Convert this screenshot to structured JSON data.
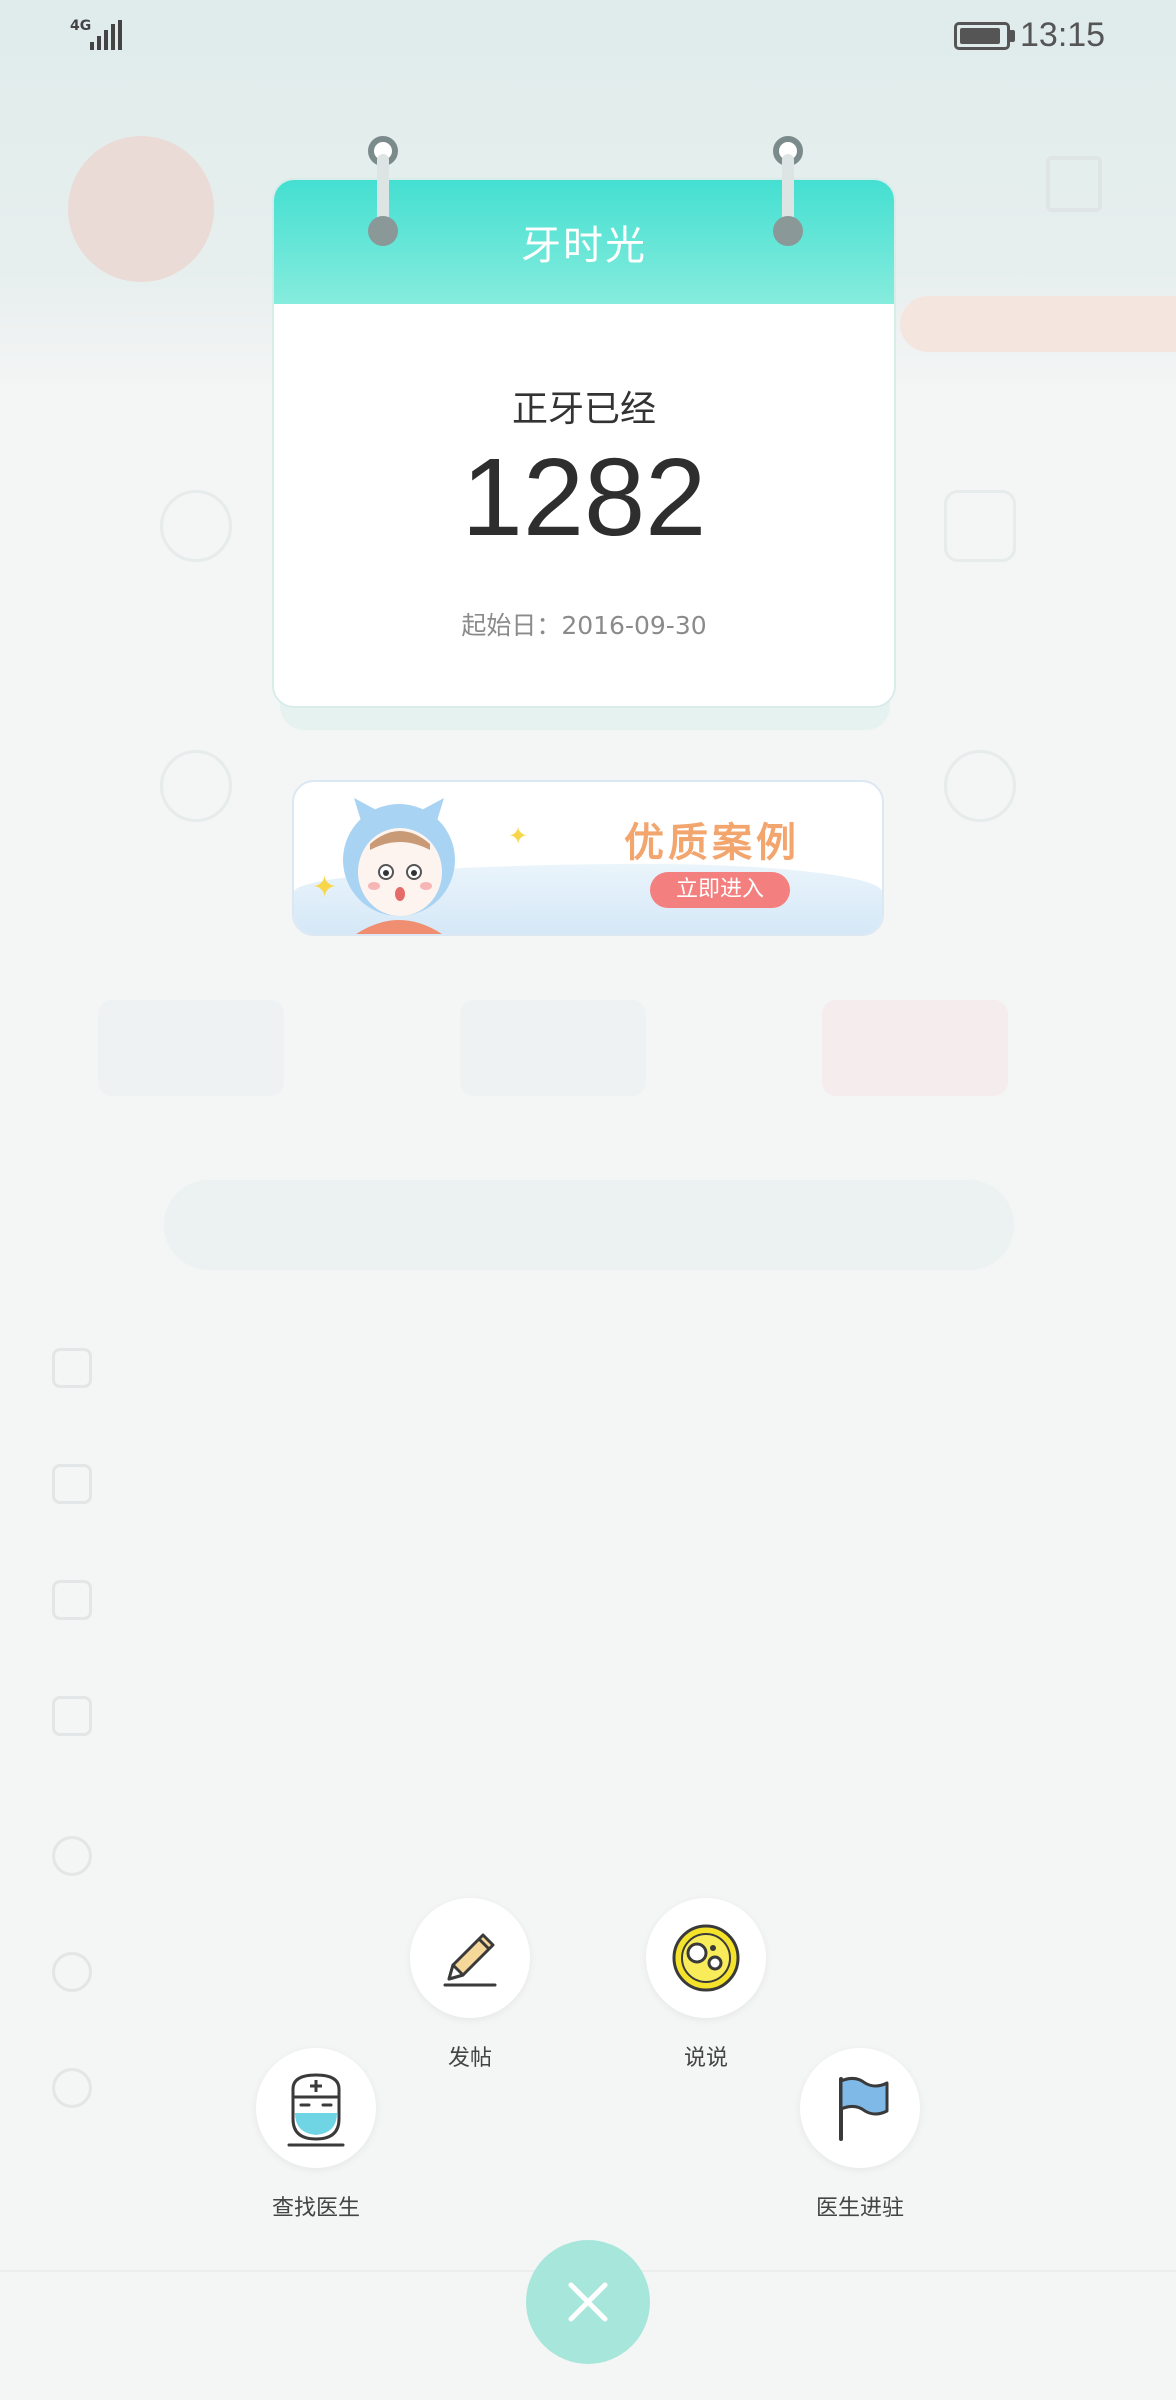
{
  "status_bar": {
    "network": "4G",
    "time": "13:15"
  },
  "calendar": {
    "title": "牙时光",
    "subtitle": "正牙已经",
    "days": "1282",
    "start_date": "起始日：2016-09-30"
  },
  "promo": {
    "title": "优质案例",
    "button_label": "立即进入"
  },
  "actions": {
    "post_label": "发帖",
    "shuoshuo_label": "说说",
    "find_doctor_label": "查找医生",
    "doctor_join_label": "医生进驻"
  },
  "colors": {
    "accent": "#44dfd1",
    "promo_orange": "#f3a56e",
    "promo_button": "#f47f7f",
    "close_button": "#a7e7db"
  }
}
